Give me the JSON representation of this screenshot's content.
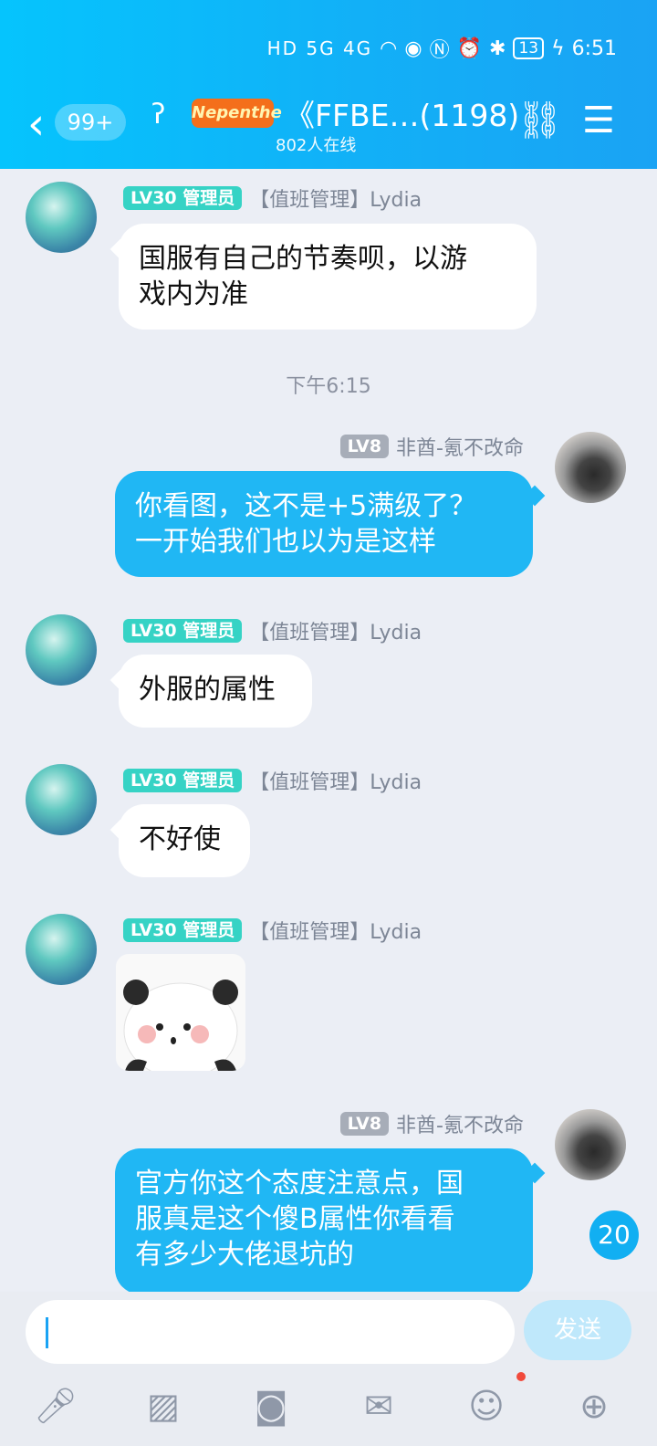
{
  "status_bar": {
    "signal_text": "HD 5G 4G",
    "battery": "13",
    "time": "6:51"
  },
  "header": {
    "back_badge": "99+",
    "logo_text": "Nepenthe",
    "title": "《FFBE…(1198)",
    "online": "802人在线"
  },
  "messages": [
    {
      "side": "left",
      "level": "LV30",
      "role": "管理员",
      "name": "【值班管理】Lydia",
      "lines": [
        "国服有自己的节奏呗，以游",
        "戏内为准"
      ]
    },
    {
      "time": "下午6:15"
    },
    {
      "side": "right",
      "level": "LV8",
      "name": "非酋-氪不改命",
      "lines": [
        "你看图，这不是+5满级了？",
        "一开始我们也以为是这样"
      ]
    },
    {
      "side": "left",
      "level": "LV30",
      "role": "管理员",
      "name": "【值班管理】Lydia",
      "lines": [
        "外服的属性"
      ]
    },
    {
      "side": "left",
      "level": "LV30",
      "role": "管理员",
      "name": "【值班管理】Lydia",
      "lines": [
        "不好使"
      ]
    },
    {
      "side": "left",
      "level": "LV30",
      "role": "管理员",
      "name": "【值班管理】Lydia",
      "sticker": "panda-sticker"
    },
    {
      "side": "right",
      "level": "LV8",
      "name": "非酋-氪不改命",
      "lines": [
        "官方你这个态度注意点，国",
        "服真是这个傻B属性你看看",
        "有多少大佬退坑的"
      ]
    }
  ],
  "unread_counter": "20",
  "input": {
    "value": "",
    "send_label": "发送"
  },
  "toolbar": [
    "mic-icon",
    "image-icon",
    "camera-icon",
    "redpacket-icon",
    "emoji-icon",
    "plus-icon"
  ],
  "colors": {
    "accent": "#12b0f7",
    "bubble_self": "#20b7f4",
    "admin_badge": "#36d3c5"
  }
}
